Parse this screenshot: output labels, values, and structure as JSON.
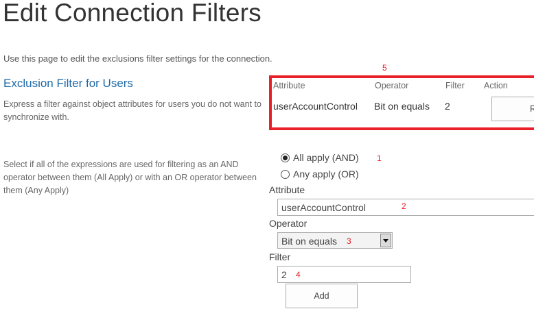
{
  "page": {
    "title": "Edit Connection Filters",
    "description": "Use this page to edit the exclusions filter settings for the connection."
  },
  "exclusion_section": {
    "title": "Exclusion Filter for Users",
    "description": "Express a filter against object attributes for users you do not want to synchronize with."
  },
  "filter_table": {
    "annotation": "5",
    "headers": {
      "attribute": "Attribute",
      "operator": "Operator",
      "filter": "Filter",
      "action": "Action"
    },
    "rows": [
      {
        "attribute": "userAccountControl",
        "operator": "Bit on equals",
        "filter": "2",
        "action_label": "Remove"
      }
    ]
  },
  "logic_section": {
    "description": "Select if all of the expressions are used for filtering as an AND operator between them (All Apply) or with an OR operator between them (Any Apply)",
    "options": [
      {
        "label": "All apply (AND)",
        "selected": true,
        "annotation": "1"
      },
      {
        "label": "Any apply (OR)",
        "selected": false
      }
    ]
  },
  "form": {
    "attribute_label": "Attribute",
    "attribute_value": "userAccountControl",
    "attribute_annotation": "2",
    "operator_label": "Operator",
    "operator_value": "Bit on equals",
    "operator_annotation": "3",
    "filter_label": "Filter",
    "filter_value": "2",
    "filter_annotation": "4",
    "add_label": "Add"
  },
  "colors": {
    "accent": "#1e6aa8",
    "highlight_border": "#e8202a"
  }
}
